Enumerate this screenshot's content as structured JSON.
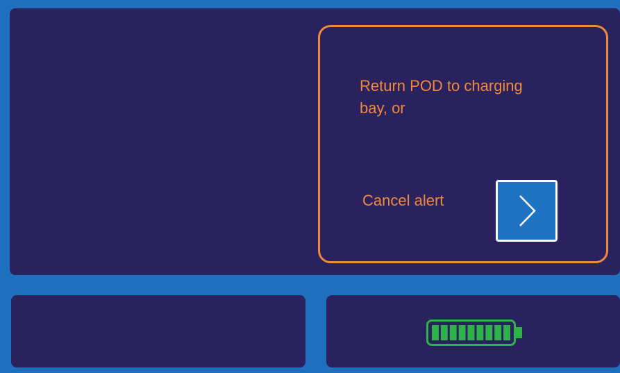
{
  "alert": {
    "message": "Return POD to charging bay, or",
    "cancel_label": "Cancel alert",
    "border_color": "#f08a3a",
    "text_color": "#f08a3a"
  },
  "cancel_button": {
    "icon": "chevron-right-icon",
    "color": "#1f73c2"
  },
  "battery": {
    "icon": "battery-icon",
    "level_fraction": 1.0,
    "bars": 9,
    "color": "#2fb24a"
  },
  "colors": {
    "frame": "#1f6fbf",
    "panel": "#2a225e"
  }
}
